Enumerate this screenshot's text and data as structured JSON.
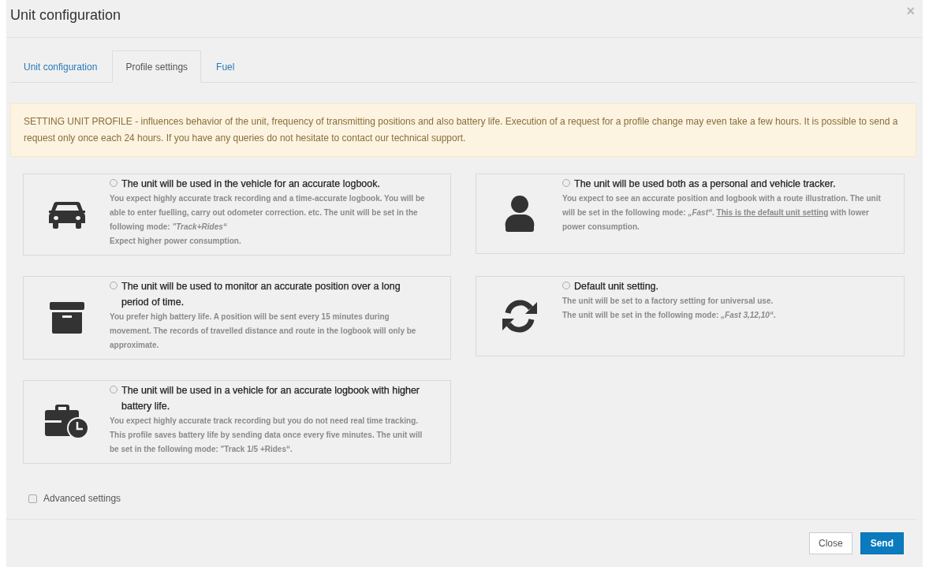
{
  "window": {
    "title": "Unit configuration",
    "close": "×"
  },
  "tabs": [
    {
      "label": "Unit configuration",
      "selected": false
    },
    {
      "label": "Profile settings",
      "selected": true
    },
    {
      "label": "Fuel",
      "selected": false
    }
  ],
  "alert": "SETTING UNIT PROFILE - influences behavior of the unit, frequency of transmitting positions and also battery life. Execution of a request for a profile change may even take a few hours. It is possible to send a request only once each 24 hours. If you have any queries do not hesitate to contact our technical support.",
  "profiles": [
    {
      "selected": false,
      "title": "The unit will be used in the vehicle for an accurate logbook.",
      "paragraphs": [
        [
          {
            "text": "You expect highly accurate track recording and a time-accurate logbook. You will be able to enter fuelling, carry out odometer correction. etc. The unit will be set in the following mode: *\"Track+Rides“*",
            "underline": false
          }
        ],
        [
          {
            "text": "Expect higher power consumption.",
            "underline": false
          }
        ]
      ]
    },
    {
      "selected": false,
      "title": "The unit will be used both as a personal and vehicle tracker.",
      "paragraphs": [
        [
          {
            "text": "You expect to see an accurate position and logbook with a route illustration. The unit will be set in the following mode: *„Fast“*. ",
            "underline": false
          },
          {
            "text": "This is the default unit setting",
            "underline": true
          },
          {
            "text": " with lower power consumption.",
            "underline": false
          }
        ]
      ]
    },
    {
      "selected": false,
      "title": "The unit will be used to monitor an accurate position over a long period of time.",
      "paragraphs": [
        [
          {
            "text": "You prefer high battery life. A position will be sent every 15 minutes during movement. The records of travelled distance and route in the logbook will only be approximate.",
            "underline": false
          }
        ]
      ]
    },
    {
      "selected": false,
      "title": "Default unit setting.",
      "paragraphs": [
        [
          {
            "text": "The unit will be set to a factory setting for universal use.",
            "underline": false
          }
        ],
        [
          {
            "text": "The unit will be set in the following mode: *„Fast 3,12,10“*.",
            "underline": false
          }
        ]
      ]
    },
    {
      "selected": false,
      "title": "The unit will be used in a vehicle for an accurate logbook with higher battery life.",
      "paragraphs": [
        [
          {
            "text": "You expect highly accurate track recording but you do not need real time tracking. This profile saves battery life by sending data once every five minutes. The unit will be set in the following mode: \"Track 1/5 +Rides“.",
            "underline": false
          }
        ]
      ]
    }
  ],
  "advanced": {
    "label": "Advanced settings",
    "checked": false
  },
  "buttons": [
    {
      "label": "Close",
      "kind": "default"
    },
    {
      "label": "Send",
      "kind": "primary"
    }
  ]
}
